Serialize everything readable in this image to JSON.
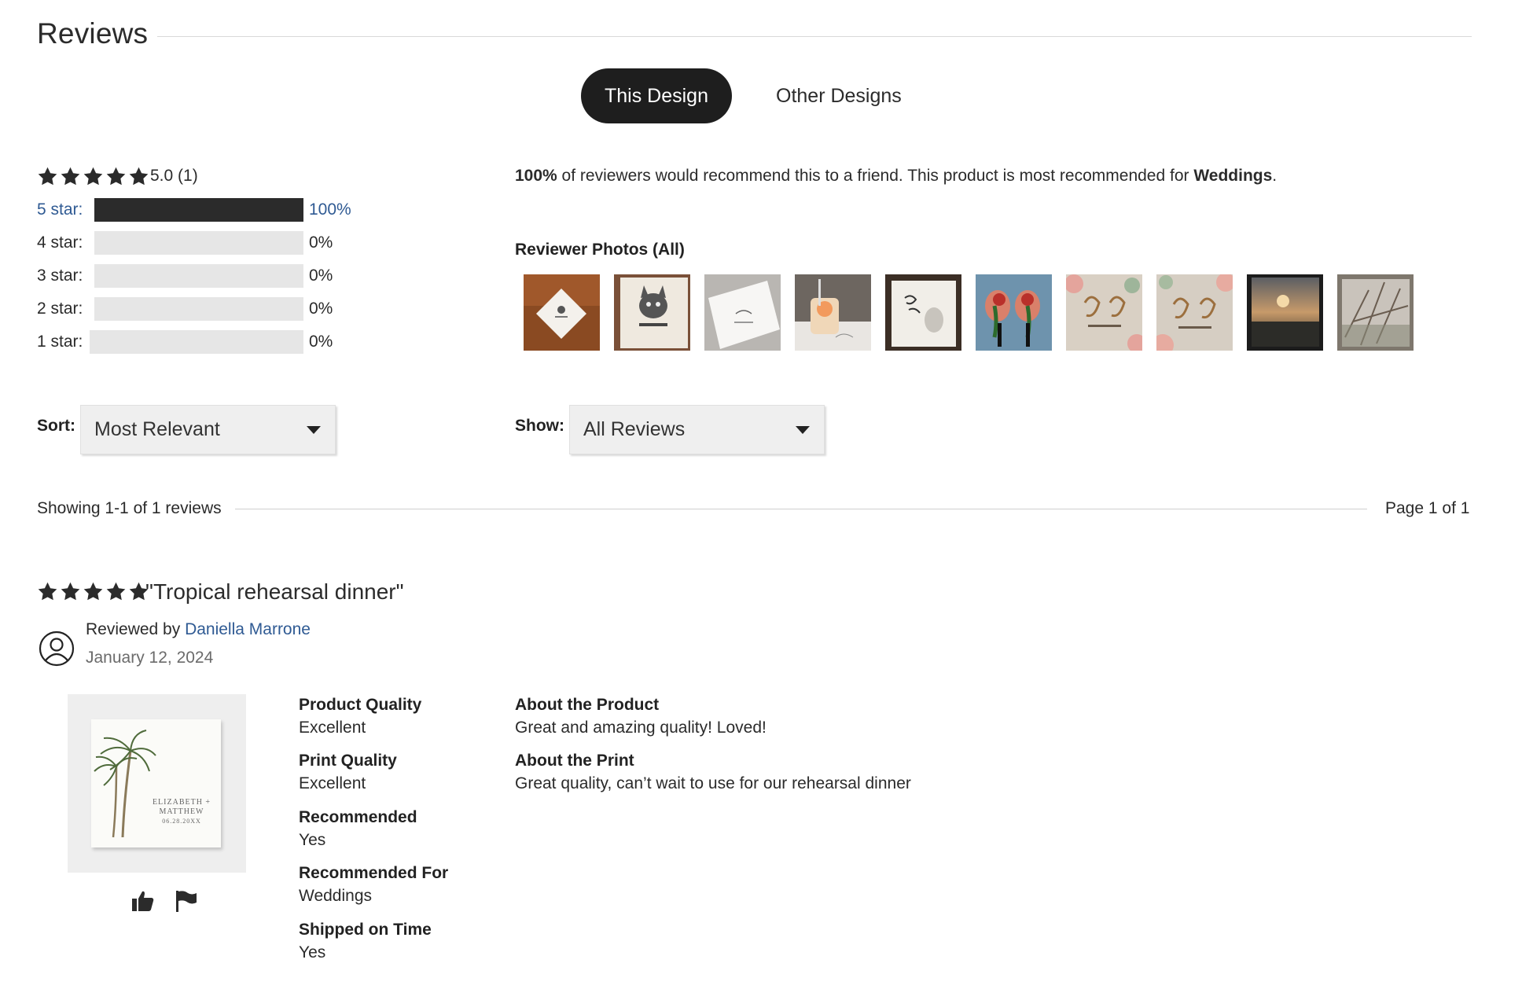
{
  "header": {
    "title": "Reviews"
  },
  "tabs": [
    {
      "label": "This Design",
      "active": true
    },
    {
      "label": "Other Designs",
      "active": false
    }
  ],
  "summary": {
    "score_text": "5.0 (1)",
    "rating": 5,
    "distribution": [
      {
        "label": "5 star:",
        "percent_text": "100%",
        "fill": 1.0
      },
      {
        "label": "4 star:",
        "percent_text": "0%",
        "fill": 0
      },
      {
        "label": "3 star:",
        "percent_text": "0%",
        "fill": 0
      },
      {
        "label": "2 star:",
        "percent_text": "0%",
        "fill": 0
      },
      {
        "label": "1 star:",
        "percent_text": "0%",
        "fill": 0
      }
    ]
  },
  "recommend": {
    "percent": "100%",
    "middle": " of reviewers would recommend this to a friend. This product is most recommended for ",
    "occasion": "Weddings",
    "end": "."
  },
  "photos": {
    "title": "Reviewer Photos (All)"
  },
  "sort": {
    "label": "Sort:",
    "value": "Most Relevant"
  },
  "show": {
    "label": "Show:",
    "value": "All Reviews"
  },
  "showing": {
    "text": "Showing 1-1 of 1 reviews",
    "page": "Page 1 of 1"
  },
  "review": {
    "title": "\"Tropical rehearsal dinner\"",
    "rating": 5,
    "reviewed_by_prefix": "Reviewed by ",
    "reviewer": "Daniella Marrone",
    "date": "January 12, 2024",
    "product_text_line1": "ELIZABETH +",
    "product_text_line2": "MATTHEW",
    "product_text_line3": "06.28.20XX",
    "attributes": [
      {
        "label": "Product Quality",
        "value": "Excellent"
      },
      {
        "label": "Print Quality",
        "value": "Excellent"
      },
      {
        "label": "Recommended",
        "value": "Yes"
      },
      {
        "label": "Recommended For",
        "value": "Weddings"
      },
      {
        "label": "Shipped on Time",
        "value": "Yes"
      }
    ],
    "about": [
      {
        "label": "About the Product",
        "value": "Great and amazing quality! Loved!"
      },
      {
        "label": "About the Print",
        "value": "Great quality, can’t wait to use for our rehearsal dinner"
      }
    ]
  },
  "colors": {
    "link": "#2f5a93",
    "dark": "#1e1e1e",
    "bar": "#2b2b2b",
    "bar_bg": "#e6e6e6"
  }
}
